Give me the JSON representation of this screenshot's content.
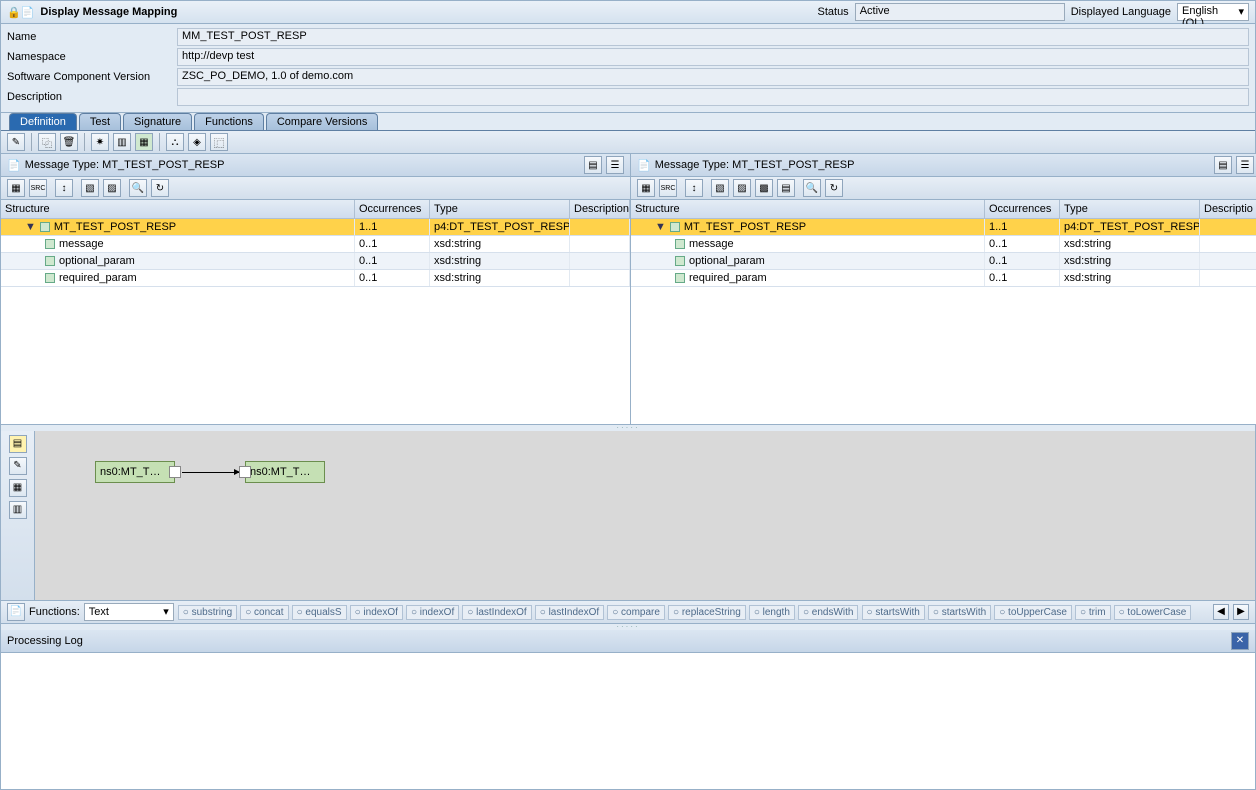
{
  "header": {
    "title": "Display Message Mapping",
    "status_label": "Status",
    "status_value": "Active",
    "lang_label": "Displayed Language",
    "lang_value": "English (OL)"
  },
  "props": {
    "name_label": "Name",
    "name_value": "MM_TEST_POST_RESP",
    "namespace_label": "Namespace",
    "namespace_value": "http://devp                                  test",
    "scv_label": "Software Component Version",
    "scv_value": "ZSC_PO_DEMO, 1.0 of demo.com",
    "desc_label": "Description",
    "desc_value": ""
  },
  "tabs": [
    "Definition",
    "Test",
    "Signature",
    "Functions",
    "Compare Versions"
  ],
  "active_tab": 0,
  "pane": {
    "left_title": "Message Type: MT_TEST_POST_RESP",
    "right_title": "Message Type: MT_TEST_POST_RESP",
    "cols": [
      "Structure",
      "Occurrences",
      "Type",
      "Description"
    ],
    "cols_r": [
      "Structure",
      "Occurrences",
      "Type",
      "Descriptio"
    ],
    "rows": [
      {
        "name": "MT_TEST_POST_RESP",
        "occ": "1..1",
        "type": "p4:DT_TEST_POST_RESP",
        "root": true
      },
      {
        "name": "message",
        "occ": "0..1",
        "type": "xsd:string"
      },
      {
        "name": "optional_param",
        "occ": "0..1",
        "type": "xsd:string"
      },
      {
        "name": "required_param",
        "occ": "0..1",
        "type": "xsd:string"
      }
    ]
  },
  "map": {
    "src": "ns0:MT_T…",
    "tgt": "ns0:MT_T…"
  },
  "functions": {
    "label": "Functions:",
    "category": "Text",
    "items": [
      "substring",
      "concat",
      "equalsS",
      "indexOf",
      "indexOf",
      "lastIndexOf",
      "lastIndexOf",
      "compare",
      "replaceString",
      "length",
      "endsWith",
      "startsWith",
      "startsWith",
      "toUpperCase",
      "trim",
      "toLowerCase"
    ]
  },
  "log": {
    "title": "Processing Log"
  }
}
